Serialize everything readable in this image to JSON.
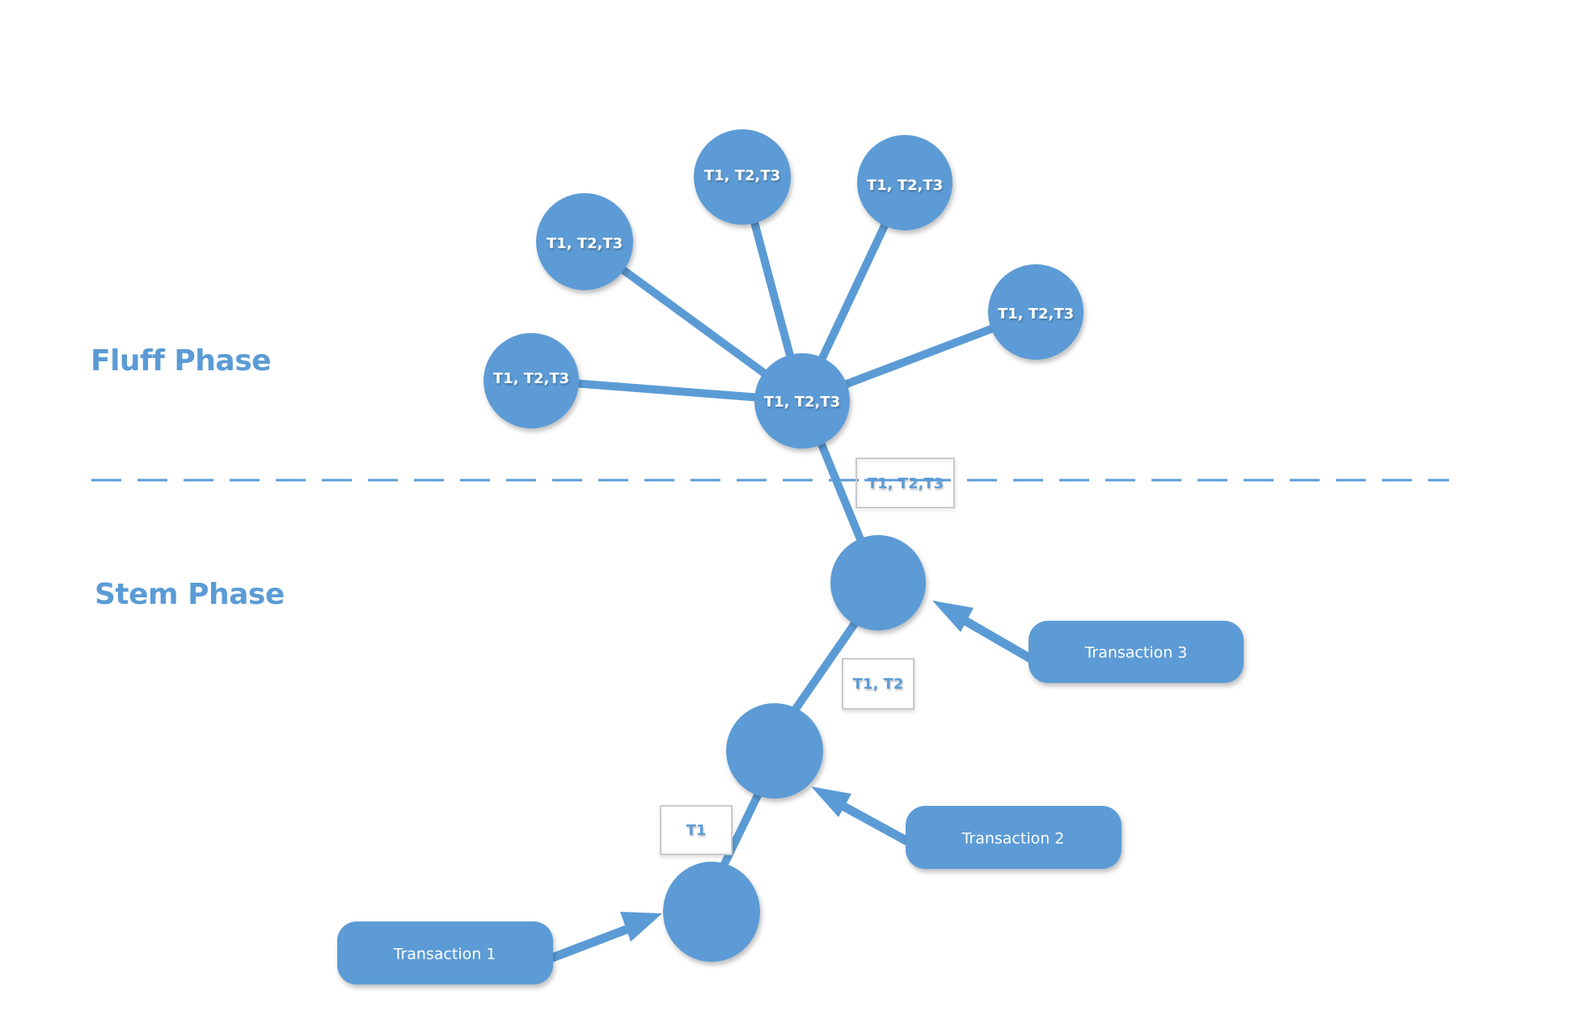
{
  "colors": {
    "accent": "#5b9bd5",
    "tag_border": "#c9c9c9",
    "background": "#ffffff"
  },
  "phases": {
    "fluff": "Fluff Phase",
    "stem": "Stem Phase"
  },
  "fluff": {
    "hub": {
      "id": "hub",
      "label": "T1, T2,T3"
    },
    "nodes": [
      {
        "id": "fluff-left",
        "label": "T1, T2,T3"
      },
      {
        "id": "fluff-upper-left",
        "label": "T1, T2,T3"
      },
      {
        "id": "fluff-top",
        "label": "T1, T2,T3"
      },
      {
        "id": "fluff-top-right",
        "label": "T1, T2,T3"
      },
      {
        "id": "fluff-right",
        "label": "T1, T2,T3"
      }
    ]
  },
  "stem": {
    "nodes": [
      {
        "id": "stem-1",
        "label": ""
      },
      {
        "id": "stem-2",
        "label": ""
      },
      {
        "id": "stem-3",
        "label": ""
      }
    ],
    "edge_tags": [
      {
        "id": "tag-t1",
        "label": "T1"
      },
      {
        "id": "tag-t1-t2",
        "label": "T1, T2"
      },
      {
        "id": "tag-t1-t2-t3",
        "label": "T1, T2,T3"
      }
    ],
    "transactions": [
      {
        "id": "tx-1",
        "label": "Transaction 1",
        "target": "stem-1"
      },
      {
        "id": "tx-2",
        "label": "Transaction 2",
        "target": "stem-2"
      },
      {
        "id": "tx-3",
        "label": "Transaction 3",
        "target": "stem-3"
      }
    ]
  }
}
